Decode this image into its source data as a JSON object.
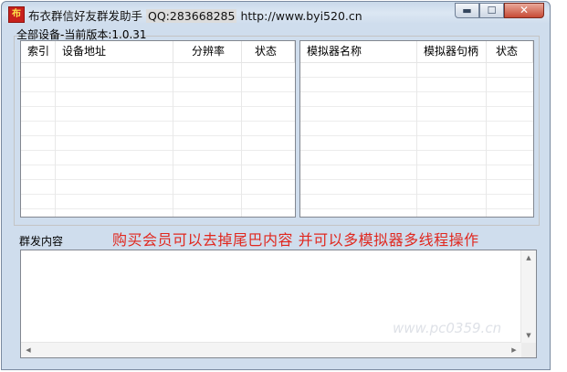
{
  "window": {
    "app_icon_glyph": "布",
    "title_app": "布衣群信好友群发助手",
    "title_qq": "QQ:283668285",
    "title_url": "http://www.byi520.cn",
    "min_glyph": "▬",
    "max_glyph": "☐",
    "close_glyph": "✕"
  },
  "devices": {
    "group_label": "全部设备-当前版本:1.0.31",
    "columns": [
      "索引",
      "设备地址",
      "分辨率",
      "状态"
    ],
    "rows": []
  },
  "emulators": {
    "columns": [
      "模拟器名称",
      "模拟器句柄",
      "状态"
    ],
    "rows": []
  },
  "broadcast": {
    "label": "群发内容",
    "promo": "购买会员可以去掉尾巴内容 并可以多模拟器多线程操作",
    "value": ""
  },
  "watermark": "www.pc0359.cn",
  "colors": {
    "promo": "#e0281f",
    "close_button": "#c74a35"
  }
}
